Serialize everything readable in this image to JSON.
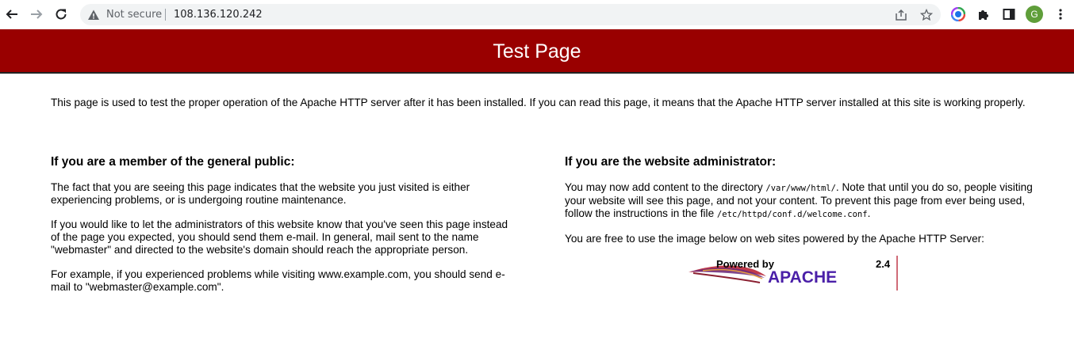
{
  "browser": {
    "security_label": "Not secure",
    "url": "108.136.120.242",
    "profile_initial": "G",
    "colors": {
      "profile": "#5f9e3a"
    }
  },
  "page": {
    "title": "Test Page",
    "intro": "This page is used to test the proper operation of the Apache HTTP server after it has been installed. If you can read this page, it means that the Apache HTTP server installed at this site is working properly.",
    "left": {
      "heading": "If you are a member of the general public:",
      "p1": "The fact that you are seeing this page indicates that the website you just visited is either experiencing problems, or is undergoing routine maintenance.",
      "p2": "If you would like to let the administrators of this website know that you've seen this page instead of the page you expected, you should send them e-mail. In general, mail sent to the name \"webmaster\" and directed to the website's domain should reach the appropriate person.",
      "p3": "For example, if you experienced problems while visiting www.example.com, you should send e-mail to \"webmaster@example.com\"."
    },
    "right": {
      "heading": "If you are the website administrator:",
      "p1_a": "You may now add content to the directory ",
      "p1_dir": "/var/www/html/",
      "p1_b": ". Note that until you do so, people visiting your website will see this page, and not your content. To prevent this page from ever being used, follow the instructions in the file ",
      "p1_file": "/etc/httpd/conf.d/welcome.conf",
      "p1_c": ".",
      "p2": "You are free to use the image below on web sites powered by the Apache HTTP Server:"
    },
    "badge": {
      "powered_by": "Powered by",
      "name": "APACHE",
      "version": "2.4"
    },
    "colors": {
      "header": "#990000"
    }
  }
}
